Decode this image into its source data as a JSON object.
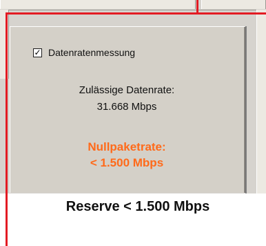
{
  "measurement": {
    "checkbox_checked": true,
    "checkbox_label": "Datenratenmessung"
  },
  "allowed_rate": {
    "label": "Zulässige Datenrate:",
    "value": "31.668 Mbps"
  },
  "null_packet_rate": {
    "label": "Nullpaketrate:",
    "value": "< 1.500 Mbps",
    "color": "#ff6a1a"
  },
  "caption": "Reserve < 1.500 Mbps",
  "annotation_color": "#e31b23"
}
